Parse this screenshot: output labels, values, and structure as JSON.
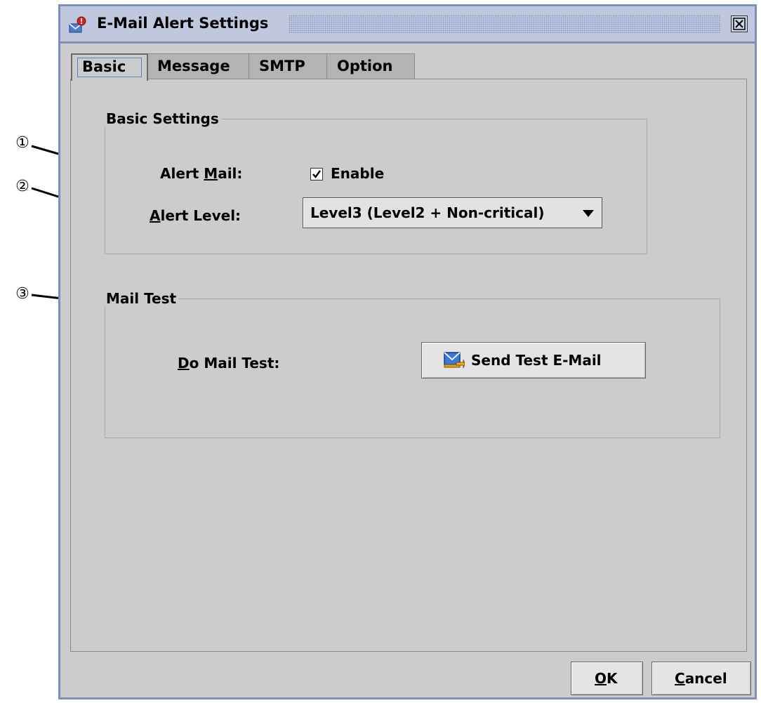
{
  "window": {
    "title": "E-Mail Alert Settings",
    "icon": "mail-alert-icon",
    "close_icon": "close-icon"
  },
  "tabs": [
    {
      "label": "Basic",
      "active": true
    },
    {
      "label": "Message",
      "active": false
    },
    {
      "label": "SMTP",
      "active": false
    },
    {
      "label": "Option",
      "active": false
    }
  ],
  "basic_settings": {
    "legend": "Basic Settings",
    "alert_mail": {
      "label_pre": "Alert ",
      "label_mnemonic": "M",
      "label_post": "ail:",
      "checkbox_label": "Enable",
      "checked": true
    },
    "alert_level": {
      "label_mnemonic": "A",
      "label_post": "lert Level:",
      "selected": "Level3 (Level2 + Non-critical)"
    }
  },
  "mail_test": {
    "legend": "Mail Test",
    "do_label_mnemonic": "D",
    "do_label_post": "o Mail Test:",
    "button_label": "Send Test E-Mail",
    "button_icon": "send-mail-icon"
  },
  "footer": {
    "ok_mnemonic": "O",
    "ok_post": "K",
    "cancel_mnemonic": "C",
    "cancel_post": "ancel"
  },
  "callouts": [
    "①",
    "②",
    "③"
  ],
  "colors": {
    "frame": "#808fb7",
    "titlebar": "#c0c8de",
    "panel": "#cccccc",
    "tab_inactive": "#b3b3b3"
  }
}
